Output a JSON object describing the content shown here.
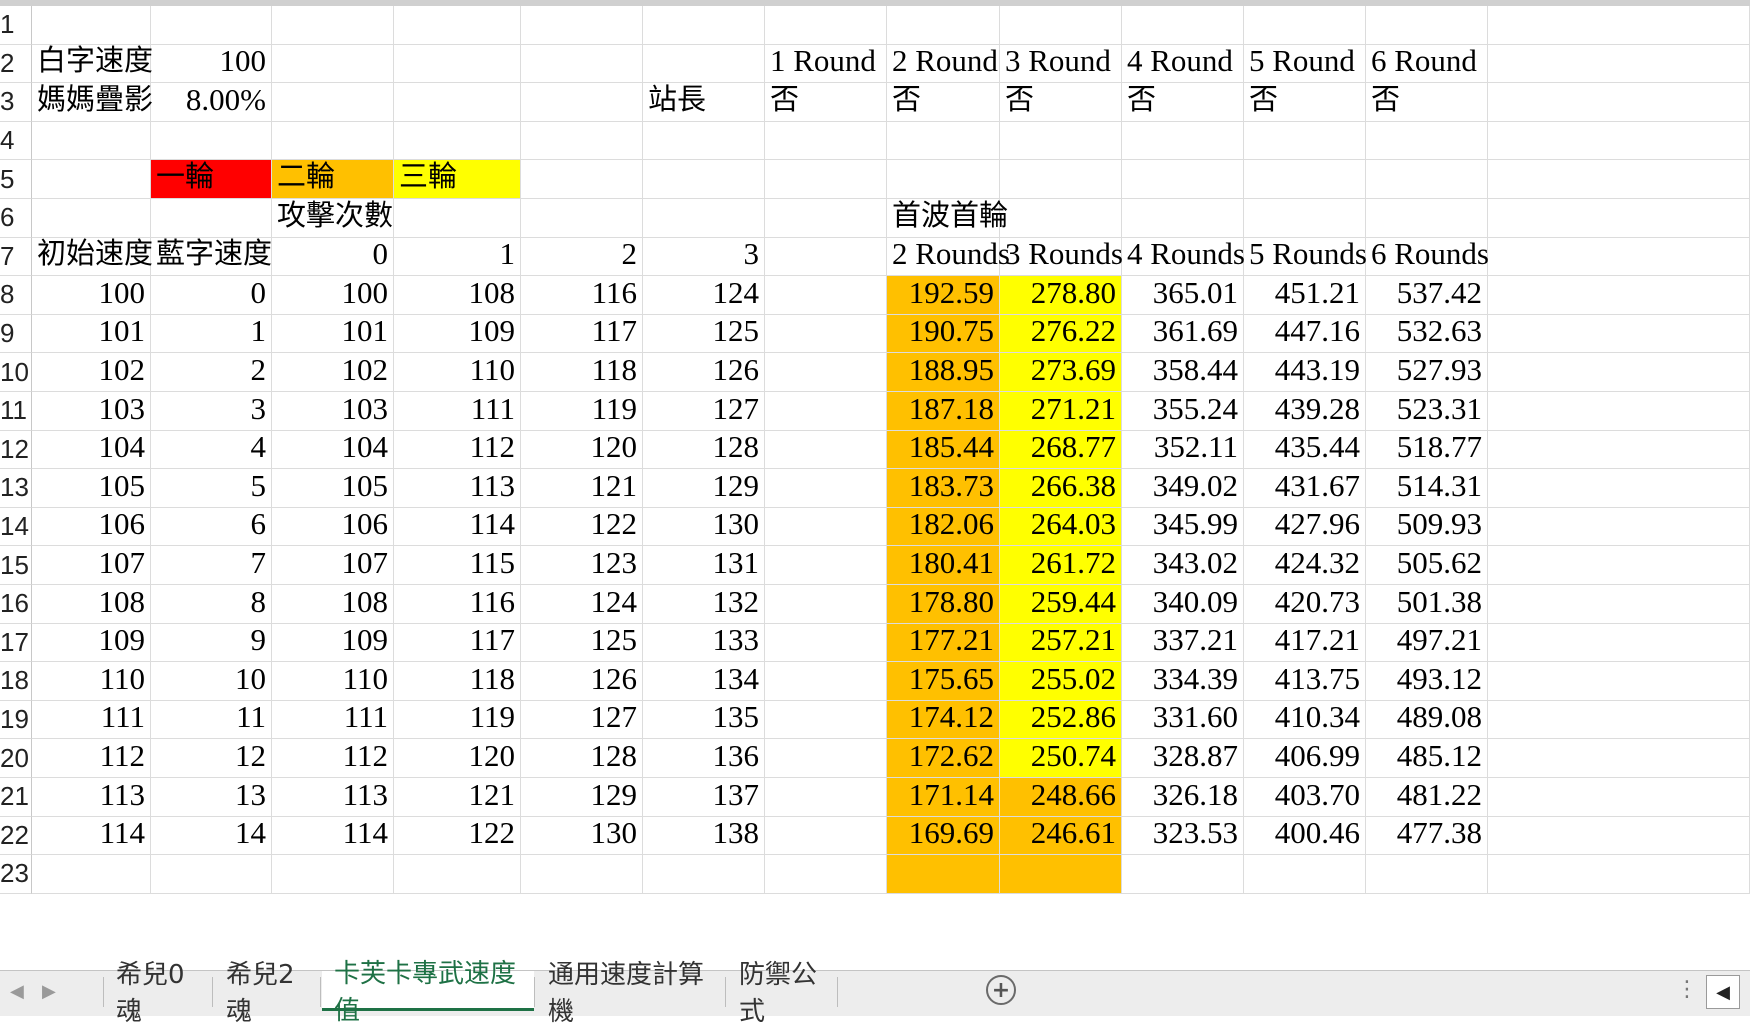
{
  "colors": {
    "red": "#ff0000",
    "orange": "#ffc000",
    "yellow": "#ffff00",
    "active_tab": "#1e7145"
  },
  "row_numbers": [
    "1",
    "2",
    "3",
    "4",
    "5",
    "6",
    "7",
    "8",
    "9",
    "10",
    "11",
    "12",
    "13",
    "14",
    "15",
    "16",
    "17",
    "18",
    "19",
    "20",
    "21",
    "22",
    "23"
  ],
  "header_cells": {
    "b2": "白字速度",
    "c2": "100",
    "b3": "媽媽疊影",
    "c3": "8.00%",
    "h3": "站長",
    "round_labels": [
      "1 Round",
      "2 Round",
      "3 Round",
      "4 Round",
      "5 Round",
      "6 Round"
    ],
    "round_values": [
      "否",
      "否",
      "否",
      "否",
      "否",
      "否"
    ],
    "legend": [
      "一輪",
      "二輪",
      "三輪"
    ],
    "attack_count": "攻擊次數",
    "first_wave": "首波首輪",
    "b7": "初始速度",
    "c7": "藍字速度",
    "attack_headers": [
      "0",
      "1",
      "2",
      "3"
    ],
    "rounds_headers": [
      "2 Rounds",
      "3 Rounds",
      "4 Rounds",
      "5 Rounds",
      "6 Rounds"
    ]
  },
  "table_rows": [
    [
      "100",
      "0",
      "100",
      "108",
      "116",
      "124",
      "192.59",
      "278.80",
      "365.01",
      "451.21",
      "537.42"
    ],
    [
      "101",
      "1",
      "101",
      "109",
      "117",
      "125",
      "190.75",
      "276.22",
      "361.69",
      "447.16",
      "532.63"
    ],
    [
      "102",
      "2",
      "102",
      "110",
      "118",
      "126",
      "188.95",
      "273.69",
      "358.44",
      "443.19",
      "527.93"
    ],
    [
      "103",
      "3",
      "103",
      "111",
      "119",
      "127",
      "187.18",
      "271.21",
      "355.24",
      "439.28",
      "523.31"
    ],
    [
      "104",
      "4",
      "104",
      "112",
      "120",
      "128",
      "185.44",
      "268.77",
      "352.11",
      "435.44",
      "518.77"
    ],
    [
      "105",
      "5",
      "105",
      "113",
      "121",
      "129",
      "183.73",
      "266.38",
      "349.02",
      "431.67",
      "514.31"
    ],
    [
      "106",
      "6",
      "106",
      "114",
      "122",
      "130",
      "182.06",
      "264.03",
      "345.99",
      "427.96",
      "509.93"
    ],
    [
      "107",
      "7",
      "107",
      "115",
      "123",
      "131",
      "180.41",
      "261.72",
      "343.02",
      "424.32",
      "505.62"
    ],
    [
      "108",
      "8",
      "108",
      "116",
      "124",
      "132",
      "178.80",
      "259.44",
      "340.09",
      "420.73",
      "501.38"
    ],
    [
      "109",
      "9",
      "109",
      "117",
      "125",
      "133",
      "177.21",
      "257.21",
      "337.21",
      "417.21",
      "497.21"
    ],
    [
      "110",
      "10",
      "110",
      "118",
      "126",
      "134",
      "175.65",
      "255.02",
      "334.39",
      "413.75",
      "493.12"
    ],
    [
      "111",
      "11",
      "111",
      "119",
      "127",
      "135",
      "174.12",
      "252.86",
      "331.60",
      "410.34",
      "489.08"
    ],
    [
      "112",
      "12",
      "112",
      "120",
      "128",
      "136",
      "172.62",
      "250.74",
      "328.87",
      "406.99",
      "485.12"
    ],
    [
      "113",
      "13",
      "113",
      "121",
      "129",
      "137",
      "171.14",
      "248.66",
      "326.18",
      "403.70",
      "481.22"
    ],
    [
      "114",
      "14",
      "114",
      "122",
      "130",
      "138",
      "169.69",
      "246.61",
      "323.53",
      "400.46",
      "477.38"
    ]
  ],
  "sheet_tabs": [
    "希兒0魂",
    "希兒2魂",
    "卡芙卡專武速度值",
    "通用速度計算機",
    "防禦公式"
  ],
  "active_tab_index": 2
}
